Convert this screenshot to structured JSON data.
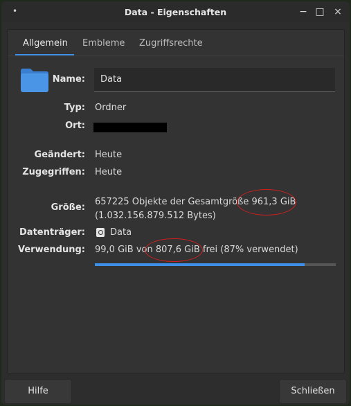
{
  "window": {
    "title": "Data - Eigenschaften",
    "menu": "•",
    "minimize": "−",
    "maximize": "□",
    "close": "×"
  },
  "tabs": [
    {
      "label": "Allgemein",
      "active": true
    },
    {
      "label": "Embleme",
      "active": false
    },
    {
      "label": "Zugriffsrechte",
      "active": false
    }
  ],
  "general": {
    "name_label": "Name:",
    "name_value": "Data",
    "type_label": "Typ:",
    "type_value": "Ordner",
    "location_label": "Ort:",
    "modified_label": "Geändert:",
    "modified_value": "Heute",
    "accessed_label": "Zugegriffen:",
    "accessed_value": "Heute",
    "size_label": "Größe:",
    "size_line1": "657225 Objekte der Gesamtgröße 961,3 GiB",
    "size_line2": "(1.032.156.879.512 Bytes)",
    "volume_label": "Datenträger:",
    "volume_value": "Data",
    "usage_label": "Verwendung:",
    "usage_value": "99,0 GiB von 807,6 GiB frei (87% verwendet)",
    "usage_fraction": 0.87
  },
  "icons": {
    "folder": "folder-icon",
    "drive": "drive-icon"
  },
  "colors": {
    "accent": "#3d8fe8",
    "annotation": "#d11f1f"
  },
  "buttons": {
    "help": "Hilfe",
    "close": "Schließen"
  }
}
